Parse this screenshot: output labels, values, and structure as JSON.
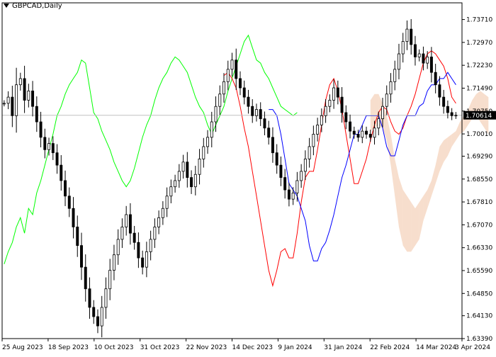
{
  "header": {
    "symbol_label": "GBPCAD,Daily"
  },
  "colors": {
    "candles": "#000000",
    "tenkan": "#ff0000",
    "kijun": "#0000ff",
    "chikou": "#00ff00",
    "kumo": "#e8a070",
    "kumo_alt": "#c8a0c8",
    "price_line": "#c0c0c0",
    "price_tag_bg": "#000000",
    "price_tag_text": "#ffffff"
  },
  "chart_data": {
    "type": "candlestick",
    "title": "GBPCAD,Daily",
    "xlabel": "",
    "ylabel": "",
    "ylim": [
      1.6339,
      1.7425
    ],
    "grid": false,
    "current_price": 1.70614,
    "current_price_label": "1.70614",
    "price_ticks": [
      "1.73710",
      "1.72970",
      "1.72230",
      "1.71490",
      "1.70750",
      "1.70010",
      "1.69290",
      "1.68550",
      "1.67810",
      "1.67070",
      "1.66330",
      "1.65590",
      "1.64850",
      "1.64130",
      "1.63390"
    ],
    "date_ticks": [
      "25 Aug 2023",
      "18 Sep 2023",
      "10 Oct 2023",
      "31 Oct 2023",
      "22 Nov 2023",
      "14 Dec 2023",
      "9 Jan 2024",
      "31 Jan 2024",
      "22 Feb 2024",
      "14 Mar 2024",
      "3 Apr 2024"
    ],
    "closes": [
      1.71,
      1.712,
      1.706,
      1.716,
      1.718,
      1.711,
      1.714,
      1.709,
      1.704,
      1.699,
      1.695,
      1.697,
      1.694,
      1.69,
      1.685,
      1.68,
      1.676,
      1.67,
      1.664,
      1.657,
      1.65,
      1.644,
      1.641,
      1.638,
      1.644,
      1.65,
      1.656,
      1.661,
      1.666,
      1.67,
      1.674,
      1.668,
      1.665,
      1.66,
      1.657,
      1.662,
      1.666,
      1.67,
      1.673,
      1.676,
      1.68,
      1.683,
      1.685,
      1.688,
      1.691,
      1.686,
      1.683,
      1.687,
      1.692,
      1.696,
      1.699,
      1.704,
      1.709,
      1.713,
      1.717,
      1.721,
      1.724,
      1.718,
      1.715,
      1.712,
      1.709,
      1.706,
      1.708,
      1.705,
      1.702,
      1.699,
      1.694,
      1.69,
      1.686,
      1.682,
      1.679,
      1.681,
      1.685,
      1.688,
      1.692,
      1.696,
      1.7,
      1.703,
      1.706,
      1.709,
      1.711,
      1.715,
      1.712,
      1.707,
      1.704,
      1.701,
      1.7,
      1.699,
      1.701,
      1.7,
      1.699,
      1.702,
      1.705,
      1.709,
      1.713,
      1.717,
      1.721,
      1.726,
      1.73,
      1.734,
      1.729,
      1.725,
      1.726,
      1.723,
      1.725,
      1.72,
      1.716,
      1.712,
      1.709,
      1.707,
      1.706,
      1.70614
    ],
    "chikou": [
      1.658,
      1.662,
      1.665,
      1.67,
      1.673,
      1.668,
      1.676,
      1.674,
      1.681,
      1.685,
      1.69,
      1.695,
      1.7,
      1.706,
      1.709,
      1.713,
      1.716,
      1.718,
      1.72,
      1.724,
      1.723,
      1.715,
      1.707,
      1.705,
      1.701,
      1.698,
      1.695,
      1.691,
      1.688,
      1.685,
      1.683,
      1.685,
      1.689,
      1.694,
      1.699,
      1.703,
      1.706,
      1.711,
      1.715,
      1.718,
      1.72,
      1.723,
      1.725,
      1.724,
      1.722,
      1.72,
      1.716,
      1.712,
      1.709,
      1.707,
      1.703,
      1.7,
      1.703,
      1.706,
      1.709,
      1.714,
      1.718,
      1.722,
      1.726,
      1.73,
      1.732,
      1.728,
      1.724,
      1.723,
      1.72,
      1.718,
      1.715,
      1.712,
      1.709,
      1.708,
      1.707,
      1.706,
      1.707
    ],
    "tenkan": [
      1.719,
      1.72,
      1.718,
      1.715,
      1.709,
      1.702,
      1.696,
      1.688,
      1.68,
      1.672,
      1.664,
      1.656,
      1.651,
      1.656,
      1.662,
      1.663,
      1.66,
      1.66,
      1.668,
      1.678,
      1.686,
      1.688,
      1.688,
      1.695,
      1.703,
      1.711,
      1.716,
      1.718,
      1.714,
      1.708,
      1.7,
      1.692,
      1.684,
      1.684,
      1.688,
      1.692,
      1.698,
      1.703,
      1.707,
      1.709,
      1.708,
      1.704,
      1.701,
      1.7,
      1.702,
      1.706,
      1.709,
      1.713,
      1.718,
      1.723,
      1.726,
      1.727,
      1.726,
      1.724,
      1.722,
      1.718,
      1.712,
      1.71
    ],
    "kijun": [
      1.708,
      1.708,
      1.706,
      1.7,
      1.692,
      1.684,
      1.682,
      1.68,
      1.676,
      1.672,
      1.664,
      1.659,
      1.659,
      1.663,
      1.665,
      1.669,
      1.674,
      1.68,
      1.686,
      1.69,
      1.695,
      1.7,
      1.7,
      1.703,
      1.706,
      1.706,
      1.706,
      1.706,
      1.702,
      1.696,
      1.693,
      1.693,
      1.698,
      1.703,
      1.706,
      1.706,
      1.706,
      1.709,
      1.71,
      1.714,
      1.716,
      1.716,
      1.718,
      1.718,
      1.72,
      1.718,
      1.716
    ],
    "kumo_upper": [
      1.711,
      1.713,
      1.713,
      1.71,
      1.706,
      1.7,
      1.692,
      1.686,
      1.682,
      1.68,
      1.678,
      1.676,
      1.678,
      1.68,
      1.682,
      1.685,
      1.69,
      1.696,
      1.698,
      1.699,
      1.7,
      1.701,
      1.704,
      1.706,
      1.708,
      1.711,
      1.713,
      1.714,
      1.713,
      1.712
    ],
    "kumo_lower": [
      1.701,
      1.702,
      1.703,
      1.702,
      1.698,
      1.69,
      1.68,
      1.67,
      1.664,
      1.662,
      1.662,
      1.664,
      1.666,
      1.672,
      1.676,
      1.68,
      1.684,
      1.688,
      1.691,
      1.693,
      1.696,
      1.698,
      1.7,
      1.701,
      1.703,
      1.705,
      1.706,
      1.704,
      1.702,
      1.7
    ]
  }
}
